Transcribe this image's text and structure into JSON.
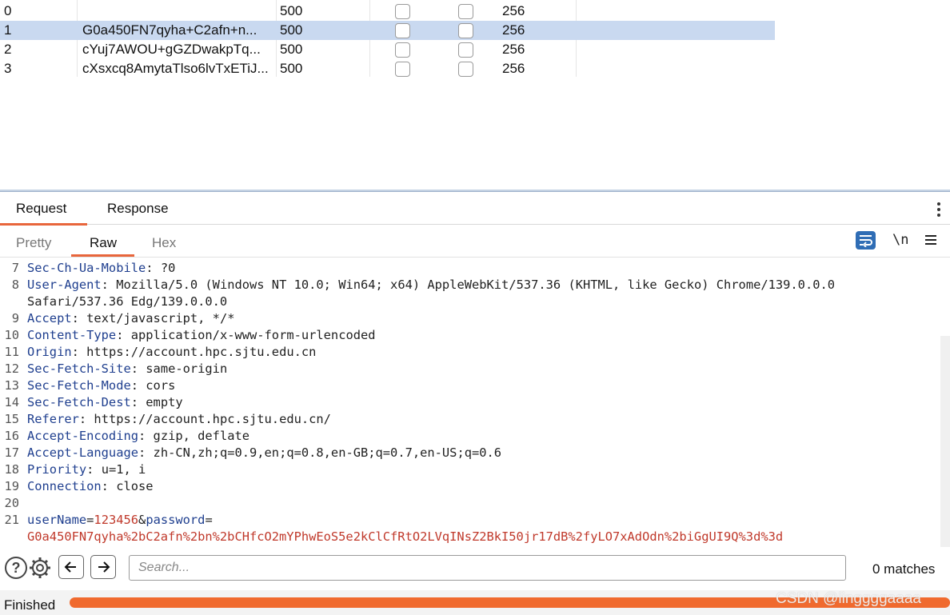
{
  "results": {
    "rows": [
      {
        "index": "0",
        "payload": "",
        "status": "500",
        "length": "256",
        "selected": false
      },
      {
        "index": "1",
        "payload": "G0a450FN7qyha+C2afn+n...",
        "status": "500",
        "length": "256",
        "selected": true
      },
      {
        "index": "2",
        "payload": "cYuj7AWOU+gGZDwakpTq...",
        "status": "500",
        "length": "256",
        "selected": false
      },
      {
        "index": "3",
        "payload": "cXsxcq8AmytaTlso6lvTxETiJ...",
        "status": "500",
        "length": "256",
        "selected": false
      }
    ]
  },
  "main_tabs": {
    "request": "Request",
    "response": "Response",
    "active": "Request"
  },
  "sub_tabs": {
    "pretty": "Pretty",
    "raw": "Raw",
    "hex": "Hex",
    "active": "Raw"
  },
  "toolbar": {
    "newline_label": "\\n",
    "wrap_icon": "wrap-lines-icon",
    "menu_icon": "hamburger-menu-icon"
  },
  "editor": {
    "lines": [
      {
        "num": "7",
        "key": "Sec-Ch-Ua-Mobile",
        "sep": ": ",
        "value": "?0"
      },
      {
        "num": "8",
        "key": "User-Agent",
        "sep": ": ",
        "value": "Mozilla/5.0 (Windows NT 10.0; Win64; x64) AppleWebKit/537.36 (KHTML, like Gecko) Chrome/139.0.0.0"
      },
      {
        "num": "",
        "key": "",
        "sep": "",
        "value": "Safari/537.36 Edg/139.0.0.0"
      },
      {
        "num": "9",
        "key": "Accept",
        "sep": ": ",
        "value": "text/javascript, */*"
      },
      {
        "num": "10",
        "key": "Content-Type",
        "sep": ": ",
        "value": "application/x-www-form-urlencoded"
      },
      {
        "num": "11",
        "key": "Origin",
        "sep": ": ",
        "value": "https://account.hpc.sjtu.edu.cn"
      },
      {
        "num": "12",
        "key": "Sec-Fetch-Site",
        "sep": ": ",
        "value": "same-origin"
      },
      {
        "num": "13",
        "key": "Sec-Fetch-Mode",
        "sep": ": ",
        "value": "cors"
      },
      {
        "num": "14",
        "key": "Sec-Fetch-Dest",
        "sep": ": ",
        "value": "empty"
      },
      {
        "num": "15",
        "key": "Referer",
        "sep": ": ",
        "value": "https://account.hpc.sjtu.edu.cn/"
      },
      {
        "num": "16",
        "key": "Accept-Encoding",
        "sep": ": ",
        "value": "gzip, deflate"
      },
      {
        "num": "17",
        "key": "Accept-Language",
        "sep": ": ",
        "value": "zh-CN,zh;q=0.9,en;q=0.8,en-GB;q=0.7,en-US;q=0.6"
      },
      {
        "num": "18",
        "key": "Priority",
        "sep": ": ",
        "value": "u=1, i"
      },
      {
        "num": "19",
        "key": "Connection",
        "sep": ": ",
        "value": "close"
      },
      {
        "num": "20",
        "key": "",
        "sep": "",
        "value": ""
      }
    ],
    "body_line_num": "21",
    "body": {
      "param1_key": "userName",
      "param1_value": "123456",
      "amp": "&",
      "param2_key": "password",
      "eq": "=",
      "param2_value": "G0a450FN7qyha%2bC2afn%2bn%2bCHfcO2mYPhwEoS5e2kClCfRtO2LVqINsZ2BkI50jr17dB%2fyLO7xAdOdn%2biGgUI9Q%3d%3d"
    }
  },
  "search": {
    "placeholder": "Search...",
    "matches": "0 matches"
  },
  "status": {
    "text": "Finished",
    "progress": 1.0
  },
  "watermark": "CSDN @linggggaaaa",
  "colors": {
    "accent": "#e8663c",
    "progress": "#f06a2e",
    "selected_row": "#c9d9f0",
    "header_key": "#1f3f8f",
    "body_value": "#c0392b",
    "wrap_button": "#2f6db5"
  }
}
